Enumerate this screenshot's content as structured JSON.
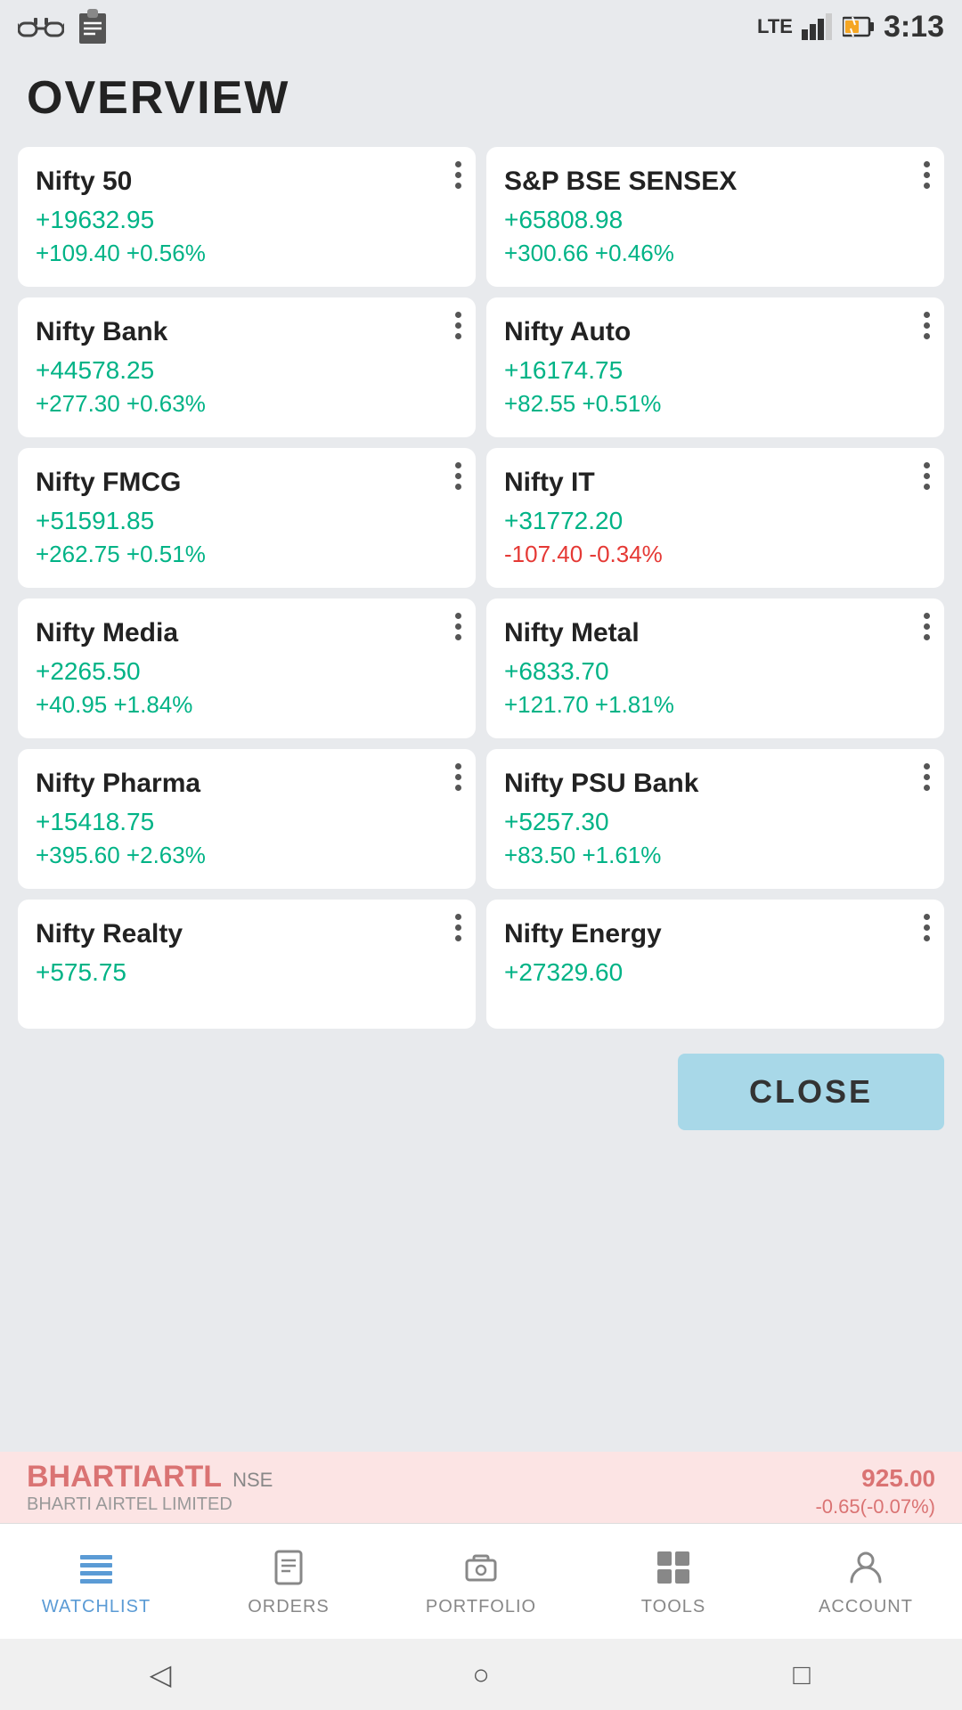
{
  "statusBar": {
    "time": "3:13",
    "network": "LTE"
  },
  "header": {
    "title": "OVERVIEW"
  },
  "cards": [
    {
      "id": "nifty50",
      "title": "Nifty 50",
      "value": "+19632.95",
      "change": "+109.40  +0.56%",
      "valueNegative": false,
      "changeNegative": false
    },
    {
      "id": "sensex",
      "title": "S&P BSE SENSEX",
      "value": "+65808.98",
      "change": "+300.66  +0.46%",
      "valueNegative": false,
      "changeNegative": false
    },
    {
      "id": "niftybank",
      "title": "Nifty Bank",
      "value": "+44578.25",
      "change": "+277.30  +0.63%",
      "valueNegative": false,
      "changeNegative": false
    },
    {
      "id": "niftyauto",
      "title": "Nifty Auto",
      "value": "+16174.75",
      "change": "+82.55  +0.51%",
      "valueNegative": false,
      "changeNegative": false
    },
    {
      "id": "niftyfmcg",
      "title": "Nifty FMCG",
      "value": "+51591.85",
      "change": "+262.75  +0.51%",
      "valueNegative": false,
      "changeNegative": false
    },
    {
      "id": "niftyit",
      "title": "Nifty IT",
      "value": "+31772.20",
      "change": "-107.40  -0.34%",
      "valueNegative": false,
      "changeNegative": true
    },
    {
      "id": "niftymedia",
      "title": "Nifty Media",
      "value": "+2265.50",
      "change": "+40.95  +1.84%",
      "valueNegative": false,
      "changeNegative": false
    },
    {
      "id": "niftymetal",
      "title": "Nifty Metal",
      "value": "+6833.70",
      "change": "+121.70  +1.81%",
      "valueNegative": false,
      "changeNegative": false
    },
    {
      "id": "niftypharma",
      "title": "Nifty Pharma",
      "value": "+15418.75",
      "change": "+395.60  +2.63%",
      "valueNegative": false,
      "changeNegative": false
    },
    {
      "id": "niftypsubank",
      "title": "Nifty PSU Bank",
      "value": "+5257.30",
      "change": "+83.50  +1.61%",
      "valueNegative": false,
      "changeNegative": false
    },
    {
      "id": "niftyrealty",
      "title": "Nifty Realty",
      "value": "+575.75",
      "change": "",
      "valueNegative": false,
      "changeNegative": false
    },
    {
      "id": "niftyenergy",
      "title": "Nifty Energy",
      "value": "+27329.60",
      "change": "",
      "valueNegative": false,
      "changeNegative": false
    }
  ],
  "closeButton": {
    "label": "CLOSE"
  },
  "ticker": {
    "name": "BHARTIARTL",
    "exchange": "NSE",
    "company": "BHARTI AIRTEL LIMITED",
    "price": "925",
    "priceFraction": ".00",
    "change": "-0.65(-0.07%)"
  },
  "bottomNav": {
    "items": [
      {
        "id": "watchlist",
        "label": "WATCHLIST",
        "active": true
      },
      {
        "id": "orders",
        "label": "ORDERS",
        "active": false
      },
      {
        "id": "portfolio",
        "label": "PORTFOLIO",
        "active": false
      },
      {
        "id": "tools",
        "label": "TOOLS",
        "active": false
      },
      {
        "id": "account",
        "label": "ACCOUNT",
        "active": false
      }
    ]
  },
  "androidNav": {
    "back": "◁",
    "home": "○",
    "recent": "□"
  }
}
